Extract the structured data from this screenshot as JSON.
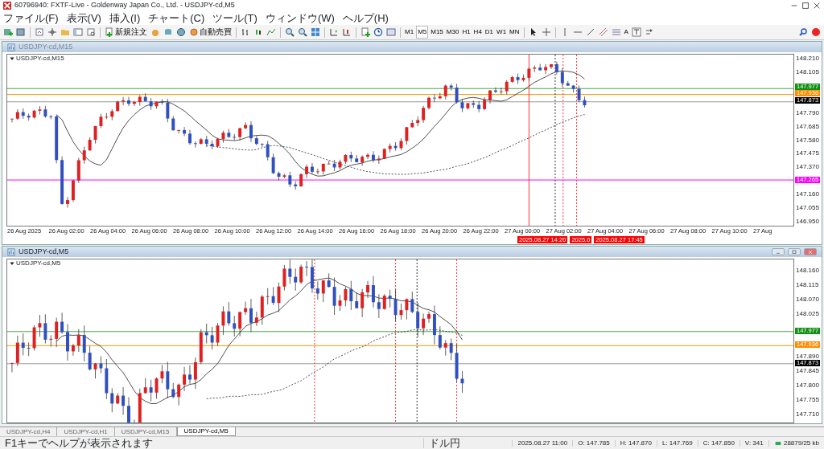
{
  "window": {
    "title": "60796940: FXTF-Live - Goldenway Japan Co., Ltd. - USDJPY-cd,M5"
  },
  "menu": [
    "ファイル(F)",
    "表示(V)",
    "挿入(I)",
    "チャート(C)",
    "ツール(T)",
    "ウィンドウ(W)",
    "ヘルプ(H)"
  ],
  "toolbar": {
    "new_order": "新規注文",
    "auto_trading": "自動売買",
    "timeframes": [
      {
        "label": "M1",
        "selected": false
      },
      {
        "label": "M5",
        "selected": true
      },
      {
        "label": "M15",
        "selected": false
      },
      {
        "label": "M30",
        "selected": false
      },
      {
        "label": "H1",
        "selected": false
      },
      {
        "label": "H4",
        "selected": false
      },
      {
        "label": "D1",
        "selected": false
      },
      {
        "label": "W1",
        "selected": false
      },
      {
        "label": "MN",
        "selected": false
      }
    ],
    "text_tool": "A"
  },
  "charts": [
    {
      "title": "USDJPY-cd,M15",
      "active": false,
      "label": "USDJPY-cd,M15",
      "yticks": [
        "148.210",
        "148.105",
        "147.790",
        "147.685",
        "147.580",
        "147.475",
        "147.370",
        "147.160",
        "147.055",
        "146.950"
      ],
      "price_tags": [
        {
          "text": "147.977",
          "color": "#109010"
        },
        {
          "text": "147.936",
          "color": "#ff8c00"
        },
        {
          "text": "147.873",
          "color": "#000000"
        },
        {
          "text": "147.265",
          "color": "#ff00ff"
        }
      ],
      "xticks": [
        "26 Aug 2025",
        "26 Aug 02:00",
        "26 Aug 04:00",
        "26 Aug 06:00",
        "26 Aug 08:00",
        "26 Aug 10:00",
        "26 Aug 12:00",
        "26 Aug 14:00",
        "26 Aug 16:00",
        "26 Aug 18:00",
        "26 Aug 20:00",
        "26 Aug 22:00",
        "27 Aug 00:00",
        "27 Aug 02:00",
        "27 Aug 04:00",
        "27 Aug 06:00",
        "27 Aug 08:00",
        "27 Aug 10:00",
        "27 Aug"
      ],
      "time_tags": [
        "2025.08.27 14:20",
        "2025.0",
        "2025.08.27 17:45"
      ]
    },
    {
      "title": "USDJPY-cd,M5",
      "active": true,
      "label": "USDJPY-cd,M5",
      "yticks": [
        "148.160",
        "148.115",
        "148.070",
        "148.025",
        "147.890",
        "147.845",
        "147.800",
        "147.755",
        "147.710"
      ],
      "price_tags": [
        {
          "text": "147.977",
          "color": "#109010"
        },
        {
          "text": "147.936",
          "color": "#ff8c00"
        },
        {
          "text": "147.873",
          "color": "#000000"
        }
      ]
    }
  ],
  "tabs": [
    {
      "label": "USDJPY-cd,H4",
      "selected": false
    },
    {
      "label": "USDJPY-cd,H1",
      "selected": false
    },
    {
      "label": "USDJPY-cd,M15",
      "selected": false
    },
    {
      "label": "USDJPY-cd,M5",
      "selected": true
    }
  ],
  "status_bar": {
    "help": "F1キーでヘルプが表示されます",
    "symbol": "ドル円",
    "time": "2025.08.27 11:00",
    "open": "O: 147.785",
    "high": "H: 147.870",
    "low": "L: 147.769",
    "close": "C: 147.850",
    "volume": "V: 341",
    "traffic": "28879/25 kb"
  }
}
